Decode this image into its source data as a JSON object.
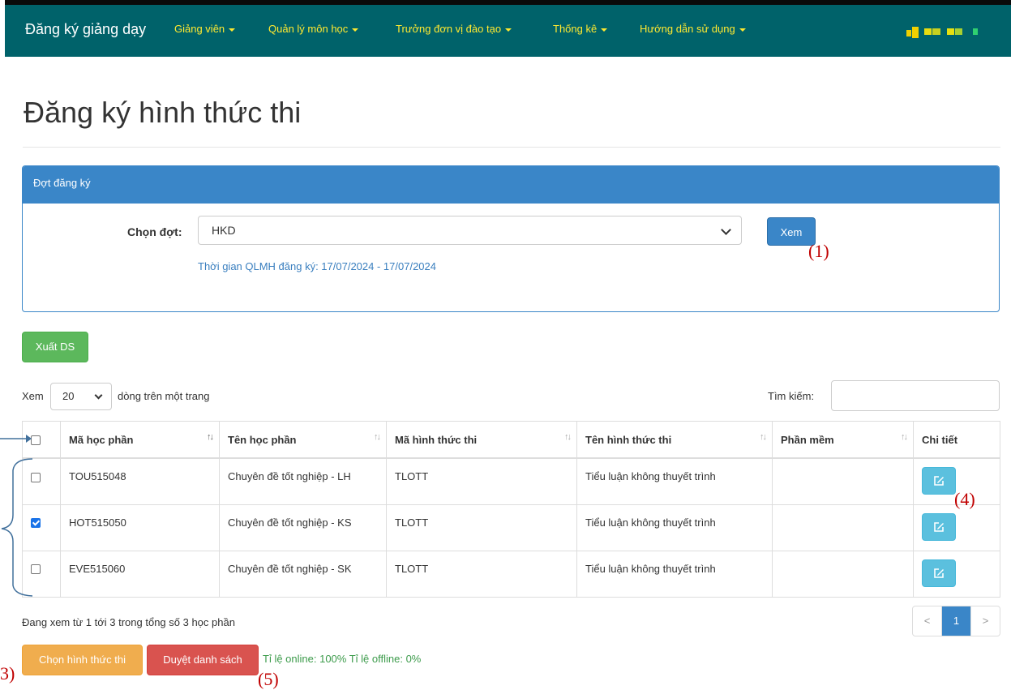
{
  "navbar": {
    "brand": "Đăng ký giảng dạy",
    "items": [
      {
        "label": "Giảng viên"
      },
      {
        "label": "Quản lý môn học"
      },
      {
        "label": "Trưởng đơn vị đào tạo"
      },
      {
        "label": "Thống kê"
      },
      {
        "label": "Hướng dẫn sử dụng"
      }
    ]
  },
  "page": {
    "title": "Đăng ký hình thức thi"
  },
  "panel": {
    "heading": "Đợt đăng ký",
    "select_label": "Chọn đợt:",
    "select_value": "HKD",
    "view_button": "Xem",
    "time_info": "Thời gian QLMH đăng ký: 17/07/2024 - 17/07/2024"
  },
  "toolbar": {
    "export_button": "Xuất DS"
  },
  "table_controls": {
    "show_label": "Xem",
    "page_length": "20",
    "rows_label": "dòng trên một trang",
    "search_label": "Tìm kiếm:",
    "search_value": ""
  },
  "table": {
    "columns": [
      "Mã học phần",
      "Tên học phần",
      "Mã hình thức thi",
      "Tên hình thức thi",
      "Phần mềm",
      "Chi tiết"
    ],
    "rows": [
      {
        "code": "TOU515048",
        "name": "Chuyên đề tốt nghiệp - LH",
        "exam_code": "TLOTT",
        "exam_name": "Tiểu luận không thuyết trình",
        "software": "",
        "checked": false
      },
      {
        "code": "HOT515050",
        "name": "Chuyên đề tốt nghiệp - KS",
        "exam_code": "TLOTT",
        "exam_name": "Tiểu luận không thuyết trình",
        "software": "",
        "checked": true
      },
      {
        "code": "EVE515060",
        "name": "Chuyên đề tốt nghiệp - SK",
        "exam_code": "TLOTT",
        "exam_name": "Tiểu luận không thuyết trình",
        "software": "",
        "checked": false
      }
    ]
  },
  "footer": {
    "info": "Đang xem từ 1 tới 3 trong tổng số 3 học phần",
    "pager": {
      "prev": "<",
      "current": "1",
      "next": ">"
    },
    "choose_button": "Chọn hình thức thi",
    "approve_button": "Duyệt danh sách",
    "ratio": "Tỉ lệ online: 100% Tỉ lệ offline: 0%"
  },
  "annotations": {
    "a1": "(1)",
    "a3": "3)",
    "a4": "(4)",
    "a5": "(5)"
  },
  "colors": {
    "navbar": "#00626a",
    "nav_link": "#ffe930",
    "primary": "#3a86c8",
    "success": "#5cb85c",
    "warning": "#f0ad4e",
    "danger": "#d9534f",
    "info": "#5bc0de",
    "annotation": "#c00000"
  }
}
